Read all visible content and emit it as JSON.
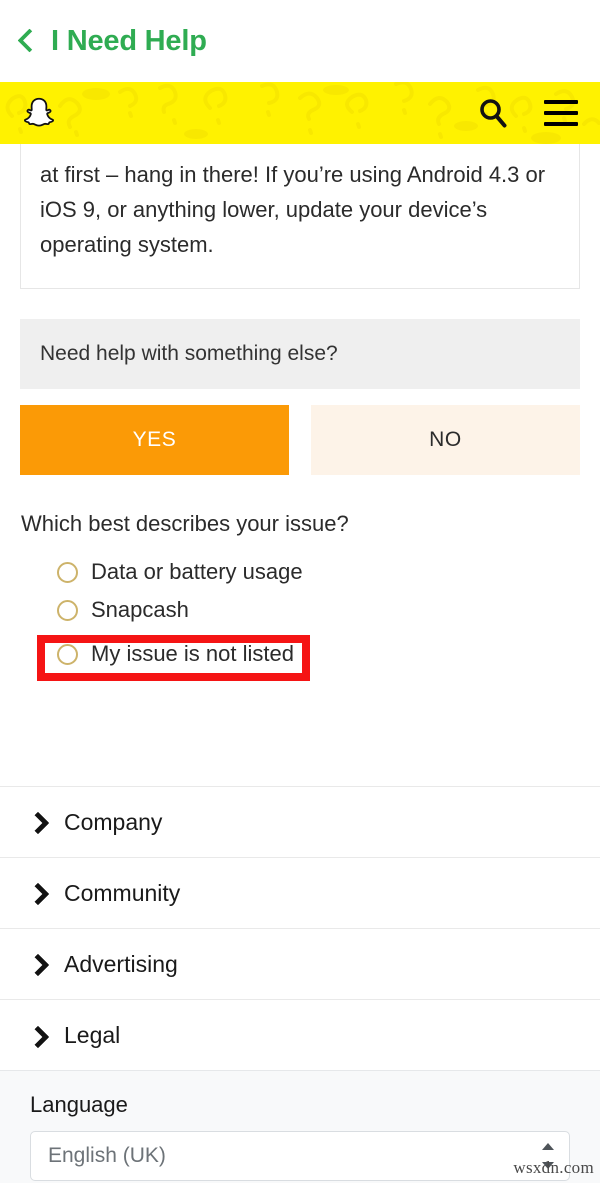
{
  "app_header": {
    "back_icon": "back-chevron-icon",
    "title": "I Need Help"
  },
  "site_bar": {
    "logo_icon": "snapchat-ghost-logo",
    "search_icon": "search-icon",
    "menu_icon": "hamburger-menu-icon",
    "background_color": "#FFF200"
  },
  "article": {
    "body_text": "at first – hang in there! If you’re using Android 4.3 or iOS 9, or anything lower, update your device’s operating system."
  },
  "feedback": {
    "prompt": "Need help with something else?",
    "yes_label": "YES",
    "no_label": "NO",
    "yes_color": "#FB9A06",
    "no_color": "#FDF3E8"
  },
  "issue_survey": {
    "question": "Which best describes your issue?",
    "options": [
      {
        "label": "Data or battery usage",
        "selected": false
      },
      {
        "label": "Snapcash",
        "selected": false
      },
      {
        "label": "My issue is not listed",
        "selected": false
      }
    ],
    "highlight": {
      "target_option_index": 2,
      "color": "#F51414"
    }
  },
  "footer": {
    "items": [
      {
        "label": "Company",
        "icon": "chevron-right-icon"
      },
      {
        "label": "Community",
        "icon": "chevron-right-icon"
      },
      {
        "label": "Advertising",
        "icon": "chevron-right-icon"
      },
      {
        "label": "Legal",
        "icon": "chevron-right-icon"
      }
    ]
  },
  "language": {
    "label": "Language",
    "selected": "English (UK)",
    "placeholder": "English (UK)",
    "spinner_icon": "updown-spinner-icon"
  },
  "watermark": {
    "text": "wsxdn.com"
  },
  "theme": {
    "brand_yellow": "#FFF200",
    "accent_green": "#2FAC52",
    "radio_gold": "#cdb36a",
    "panel_gray": "#efefef"
  }
}
